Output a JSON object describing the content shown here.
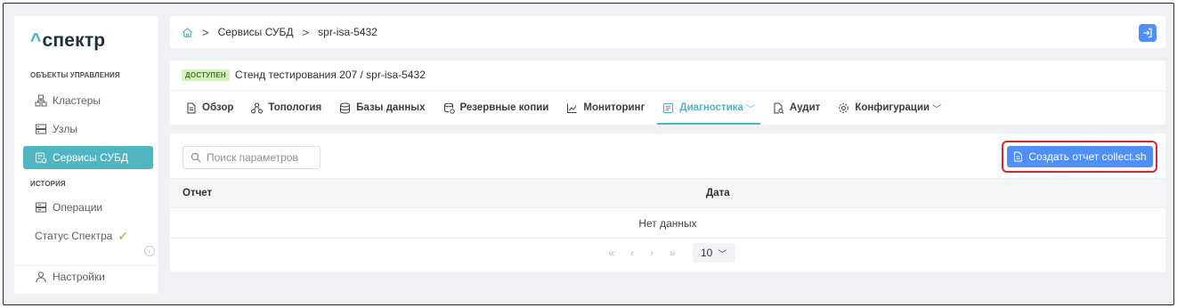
{
  "brand": {
    "caret": "^",
    "name": "спектр"
  },
  "sidebar": {
    "sections": [
      {
        "title": "ОБЪЕКТЫ УПРАВЛЕНИЯ"
      },
      {
        "title": "ИСТОРИЯ"
      }
    ],
    "items": [
      {
        "label": "Кластеры",
        "icon": "cluster-icon"
      },
      {
        "label": "Узлы",
        "icon": "server-icon"
      },
      {
        "label": "Сервисы СУБД",
        "icon": "db-service-icon",
        "active": true
      },
      {
        "label": "Операции",
        "icon": "operations-icon"
      },
      {
        "label": "Статус Спектра",
        "icon": "check-icon"
      },
      {
        "label": "Настройки",
        "icon": "user-icon"
      }
    ]
  },
  "breadcrumb": {
    "items": [
      "Сервисы СУБД",
      "spr-isa-5432"
    ],
    "separator": ">"
  },
  "info": {
    "status_badge": "ДОСТУПЕН",
    "stand": "Стенд тестирования 207 /  spr-isa-5432"
  },
  "tabs": [
    {
      "label": "Обзор",
      "icon": "document-icon"
    },
    {
      "label": "Топология",
      "icon": "topology-icon"
    },
    {
      "label": "Базы данных",
      "icon": "database-icon"
    },
    {
      "label": "Резервные копии",
      "icon": "backup-icon"
    },
    {
      "label": "Мониторинг",
      "icon": "chart-icon"
    },
    {
      "label": "Диагностика",
      "icon": "diagnostics-icon",
      "active": true,
      "dropdown": true
    },
    {
      "label": "Аудит",
      "icon": "audit-icon"
    },
    {
      "label": "Конфигурации",
      "icon": "gear-icon",
      "dropdown": true
    }
  ],
  "toolbar": {
    "search_placeholder": "Поиск параметров",
    "create_button": "Создать отчет collect.sh"
  },
  "table": {
    "columns": [
      "Отчет",
      "Дата"
    ],
    "empty_text": "Нет данных"
  },
  "pagination": {
    "first": "«",
    "prev": "‹",
    "next": "›",
    "last": "»",
    "page_size": "10"
  },
  "colors": {
    "accent": "#4fb6c1",
    "primary_button": "#4f8ff7",
    "highlight_border": "#d42a2a",
    "status_green": "#3f7e1f"
  }
}
